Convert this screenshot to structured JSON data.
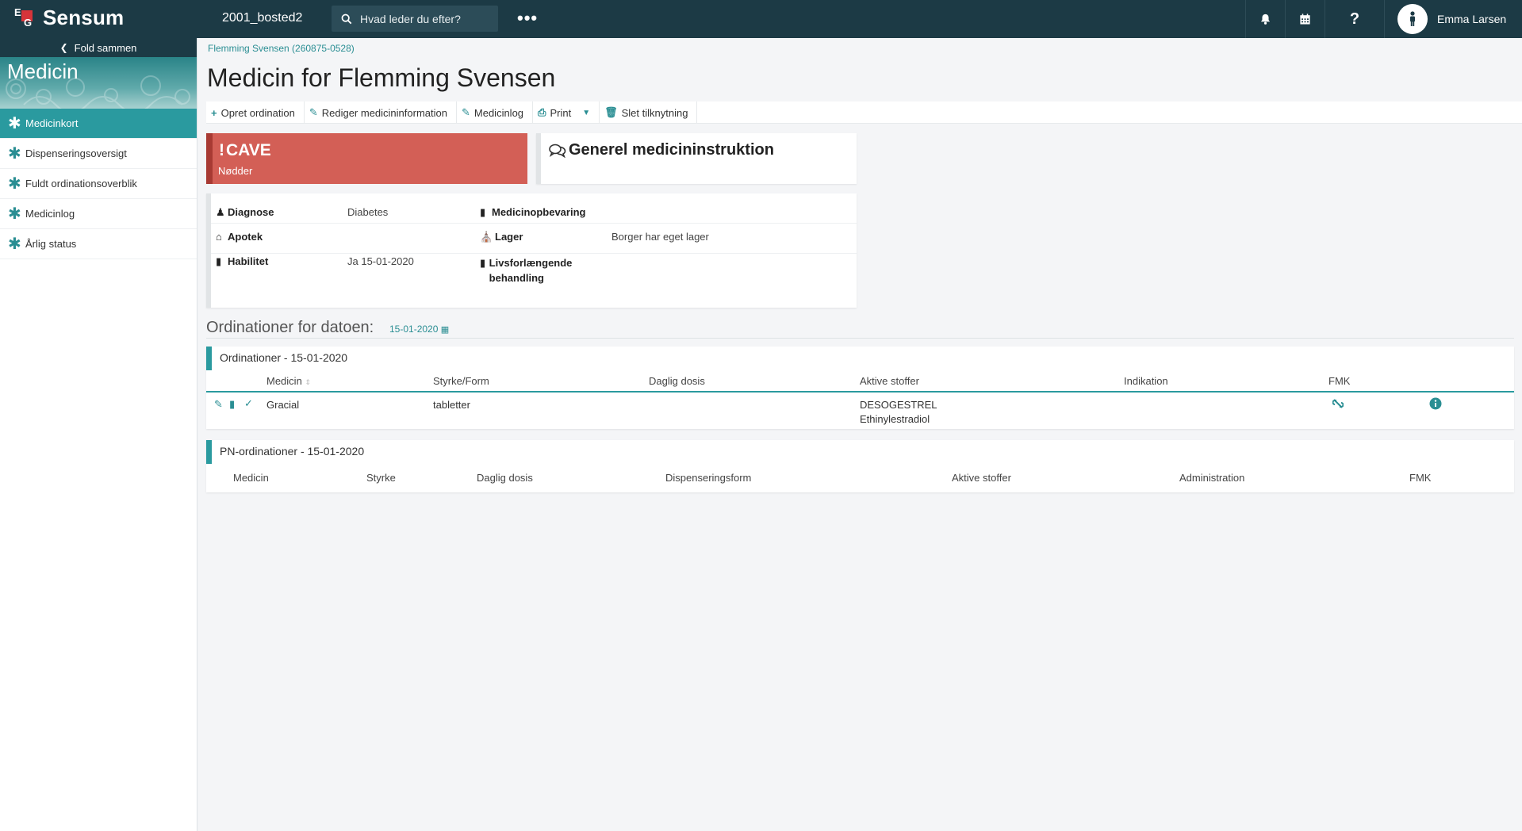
{
  "topbar": {
    "logo_text": "Sensum",
    "logo_letters": [
      "E",
      "G"
    ],
    "tenant": "2001_bosted2",
    "search_placeholder": "Hvad leder du efter?",
    "more": "•••",
    "user_name": "Emma Larsen"
  },
  "sidebar": {
    "fold_label": "Fold sammen",
    "section_title": "Medicin",
    "items": [
      {
        "label": "Medicinkort",
        "active": true
      },
      {
        "label": "Dispenseringsoversigt",
        "active": false
      },
      {
        "label": "Fuldt ordinationsoverblik",
        "active": false
      },
      {
        "label": "Medicinlog",
        "active": false
      },
      {
        "label": "Årlig status",
        "active": false
      }
    ]
  },
  "main": {
    "breadcrumb": "Flemming Svensen (260875-0528)",
    "title": "Medicin for Flemming Svensen",
    "toolbar": {
      "create": "Opret ordination",
      "edit": "Rediger medicininformation",
      "log": "Medicinlog",
      "print": "Print",
      "delete": "Slet tilknytning"
    },
    "cave": {
      "title": "CAVE",
      "subtitle": "Nødder"
    },
    "instruction_title": "Generel medicininstruktion",
    "info": {
      "diagnose_label": "Diagnose",
      "diagnose_value": "Diabetes",
      "opbevaring_label": "Medicinopbevaring",
      "opbevaring_value": "",
      "apotek_label": "Apotek",
      "apotek_value": "",
      "lager_label": "Lager",
      "lager_value": "Borger har eget lager",
      "habilitet_label": "Habilitet",
      "habilitet_value": "Ja 15-01-2020",
      "livs_label": "Livsforlængende behandling",
      "livs_value": ""
    },
    "ordinations_heading": "Ordinationer for datoen:",
    "ordinations_date": "15-01-2020",
    "ordination_panel": {
      "title": "Ordinationer - 15-01-2020",
      "columns": [
        "Medicin",
        "Styrke/Form",
        "Daglig dosis",
        "Aktive stoffer",
        "Indikation",
        "FMK"
      ],
      "rows": [
        {
          "medicin": "Gracial",
          "styrke": "tabletter",
          "dosis": "",
          "stoffer": [
            "DESOGESTREL",
            "Ethinylestradiol"
          ],
          "indikation": ""
        }
      ]
    },
    "pn_panel": {
      "title": "PN-ordinationer - 15-01-2020",
      "columns": [
        "Medicin",
        "Styrke",
        "Daglig dosis",
        "Dispenseringsform",
        "Aktive stoffer",
        "Administration",
        "FMK"
      ]
    }
  },
  "colors": {
    "topbar": "#1c3a45",
    "accent": "#2a9a9f",
    "cave": "#d35f56"
  }
}
